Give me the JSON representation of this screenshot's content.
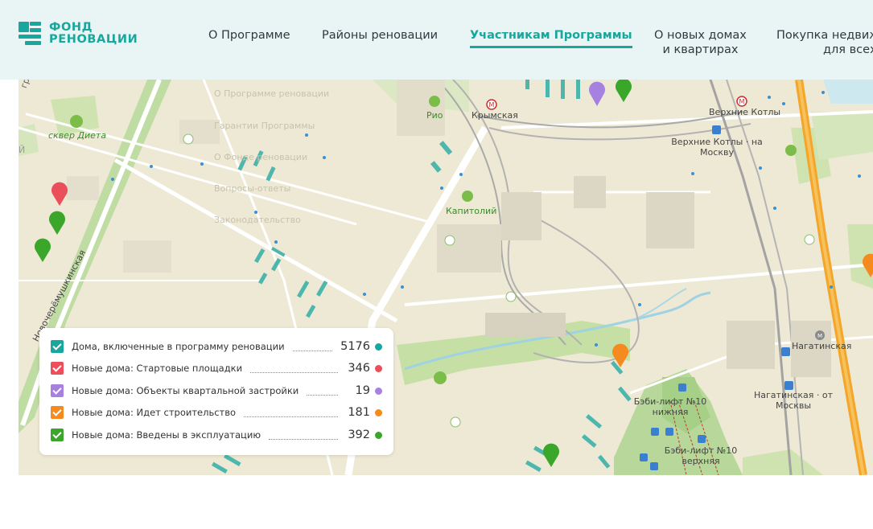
{
  "header": {
    "logo_line1": "ФОНД",
    "logo_line2": "РЕНОВАЦИИ",
    "nav": [
      {
        "label": "О Программе",
        "active": false
      },
      {
        "label": "Районы реновации",
        "active": false
      },
      {
        "label": "Участникам Программы",
        "active": true
      },
      {
        "label_line1": "О новых домах",
        "label_line2": "и квартирах",
        "active": false
      },
      {
        "label_line1": "Покупка недвиж",
        "label_line2": "для всех",
        "active": false
      }
    ]
  },
  "map": {
    "ghost_menu": [
      "О Программе реновации",
      "Гарантии Программы",
      "О Фонде реновации",
      "Вопросы-ответы",
      "Законодательство"
    ],
    "labels": {
      "park": "сквер Диета",
      "street": "Новочерёмушкинская",
      "mall_rio": "Рио",
      "metro_krymskaya": "Крымская",
      "metro_verkhnie_kotly": "Верхние Котлы",
      "station_verkhnie_kotly_1": "Верхние Котлы · на",
      "station_verkhnie_kotly_2": "Москву",
      "mall_kapitoliy": "Капитолий",
      "nagatinskaya": "Нагатинская",
      "nagatinskaya_stop_1": "Нагатинская · от",
      "nagatinskaya_stop_2": "Москвы",
      "lift_lower_1": "Бэби-лифт №10",
      "lift_lower_2": "нижняя",
      "lift_upper_1": "Бэби-лифт №10",
      "lift_upper_2": "верхняя",
      "edge_left_1": "Й",
      "edge_left_2": "гри"
    },
    "colors": {
      "included": "#17a79c",
      "start": "#ea4f5a",
      "quarterly": "#a781e0",
      "construction": "#f58a1f",
      "completed": "#3aa62a"
    }
  },
  "legend": [
    {
      "label": "Дома, включенные в программу реновации",
      "count": "5176",
      "color": "#17a79c"
    },
    {
      "label": "Новые дома: Стартовые площадки",
      "count": "346",
      "color": "#ea4f5a"
    },
    {
      "label": "Новые дома: Объекты квартальной застройки",
      "count": "19",
      "color": "#a781e0"
    },
    {
      "label": "Новые дома: Идет строительство",
      "count": "181",
      "color": "#f58a1f"
    },
    {
      "label": "Новые дома: Введены в эксплуатацию",
      "count": "392",
      "color": "#3aa62a"
    }
  ]
}
